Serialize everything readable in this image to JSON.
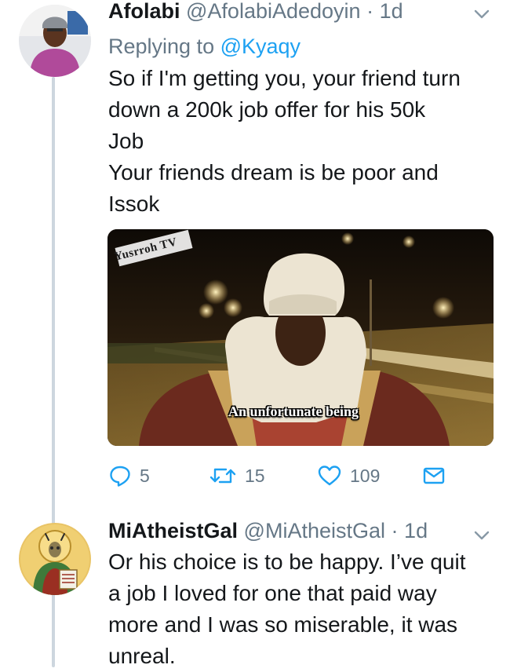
{
  "tweets": [
    {
      "name": "Afolabi",
      "handle": "@AfolabiAdedoyin",
      "time": "1d",
      "replying_prefix": "Replying to",
      "replying_to": "@Kyaqy",
      "lines": [
        "So if I'm getting you, your friend turn",
        "down a 200k job offer for his 50k",
        "Job",
        "Your friends dream is be poor and",
        "Issok"
      ],
      "media": {
        "watermark": "Yusrroh TV",
        "caption": "An unfortunate being"
      },
      "actions": {
        "replies": "5",
        "retweets": "15",
        "likes": "109"
      }
    },
    {
      "name": "MiAtheistGal",
      "handle": "@MiAtheistGal",
      "time": "1d",
      "lines": [
        "Or his choice is to be happy. I’ve quit",
        "a job I loved for one that paid way",
        "more and I was so miserable, it was",
        "unreal."
      ]
    }
  ],
  "separator": "·",
  "icons": {
    "menu": "chevron-down-icon",
    "reply": "reply-icon",
    "retweet": "retweet-icon",
    "like": "heart-icon",
    "dm": "envelope-icon"
  },
  "colors": {
    "text": "#14171a",
    "secondary": "#657786",
    "link": "#1da1f2",
    "thread_line": "#cdd6de"
  }
}
